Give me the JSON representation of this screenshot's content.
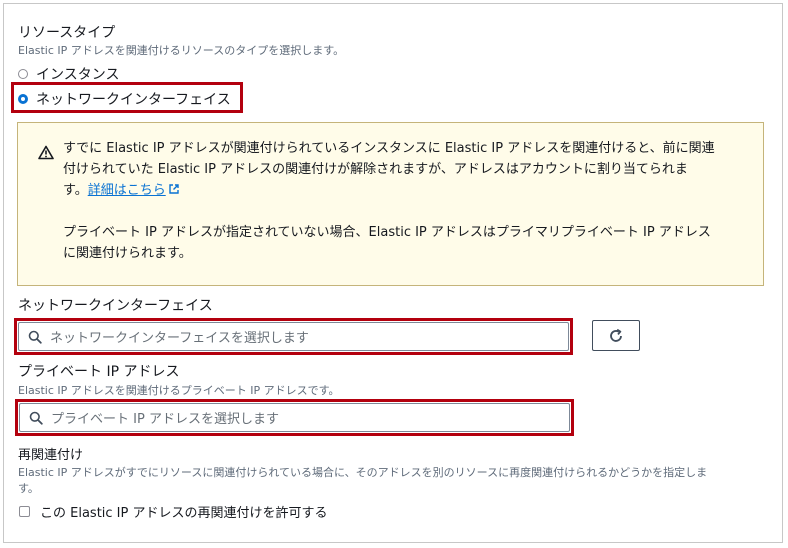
{
  "resource_type": {
    "title": "リソースタイプ",
    "description": "Elastic IP アドレスを関連付けるリソースのタイプを選択します。",
    "options": [
      {
        "label": "インスタンス",
        "selected": false
      },
      {
        "label": "ネットワークインターフェイス",
        "selected": true
      }
    ]
  },
  "alert": {
    "icon": "warning-icon",
    "paragraph1_line1": "すでに Elastic IP アドレスが関連付けられているインスタンスに Elastic IP アドレスを関連付けると、前に関連",
    "paragraph1_line2": "付けられていた Elastic IP アドレスの関連付けが解除されますが、アドレスはアカウントに割り当てられま",
    "paragraph1_line3_prefix": "す。",
    "link_label": "詳細はこちら",
    "paragraph2_line1": "プライベート IP アドレスが指定されていない場合、Elastic IP アドレスはプライマリプライベート IP アドレス",
    "paragraph2_line2": "に関連付けられます。"
  },
  "network_interface": {
    "title": "ネットワークインターフェイス",
    "placeholder": "ネットワークインターフェイスを選択します"
  },
  "private_ip": {
    "title": "プライベート IP アドレス",
    "description": "Elastic IP アドレスを関連付けるプライベート IP アドレスです。",
    "placeholder": "プライベート IP アドレスを選択します"
  },
  "reassociation": {
    "title": "再関連付け",
    "description_line1": "Elastic IP アドレスがすでにリソースに関連付けられている場合に、そのアドレスを別のリソースに再度関連付けられるかどうかを指定しま",
    "description_line2": "す。",
    "checkbox_label": "この Elastic IP アドレスの再関連付けを許可する",
    "checked": false
  },
  "colors": {
    "highlight": "#b3000e",
    "accent": "#0972d3",
    "alert_bg": "#fffce9",
    "alert_border": "#c5b47a"
  }
}
